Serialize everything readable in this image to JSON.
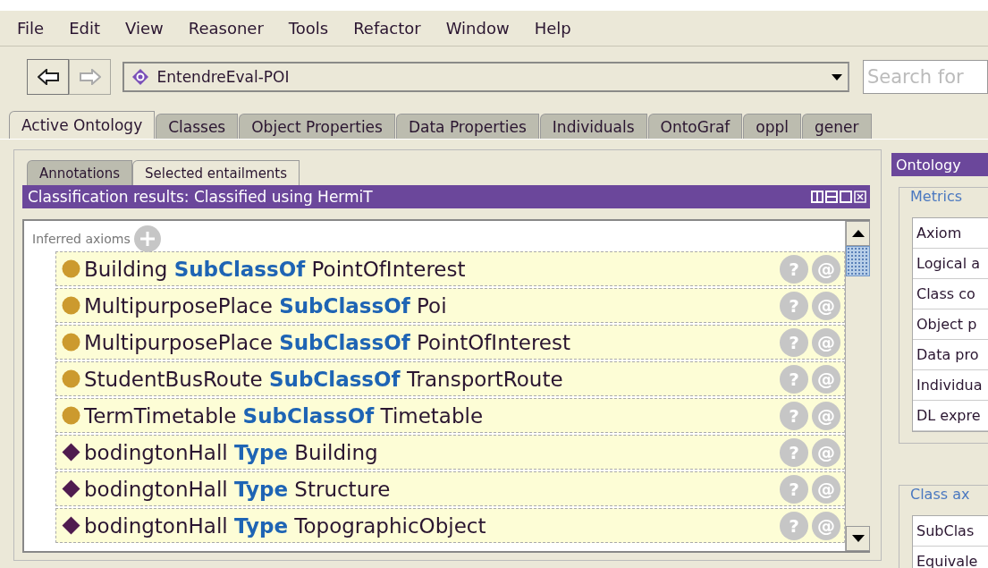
{
  "menu": [
    "File",
    "Edit",
    "View",
    "Reasoner",
    "Tools",
    "Refactor",
    "Window",
    "Help"
  ],
  "toolbar": {
    "ontology": "EntendreEval-POI",
    "search": {
      "placeholder": "Search for"
    }
  },
  "tabs": [
    {
      "label": "Active Ontology",
      "selected": true
    },
    {
      "label": "Classes",
      "selected": false
    },
    {
      "label": "Object Properties",
      "selected": false
    },
    {
      "label": "Data Properties",
      "selected": false
    },
    {
      "label": "Individuals",
      "selected": false
    },
    {
      "label": "OntoGraf",
      "selected": false
    },
    {
      "label": "oppl",
      "selected": false
    },
    {
      "label": "gener",
      "selected": false
    }
  ],
  "left_panel": {
    "tabs": [
      {
        "label": "Annotations",
        "selected": false
      },
      {
        "label": "Selected entailments",
        "selected": true
      }
    ],
    "title": "Classification results: Classified using HermiT",
    "section": "Inferred axioms",
    "axioms": [
      {
        "kind": "class",
        "text": "Building **SubClassOf** PointOfInterest",
        "actions": [
          "?",
          "@"
        ]
      },
      {
        "kind": "class",
        "text": "MultipurposePlace **SubClassOf** Poi",
        "actions": [
          "?",
          "@"
        ]
      },
      {
        "kind": "class",
        "text": "MultipurposePlace **SubClassOf** PointOfInterest",
        "actions": [
          "?",
          "@"
        ]
      },
      {
        "kind": "class",
        "text": "StudentBusRoute **SubClassOf** TransportRoute",
        "actions": [
          "?",
          "@"
        ]
      },
      {
        "kind": "class",
        "text": "TermTimetable **SubClassOf** Timetable",
        "actions": [
          "?",
          "@"
        ]
      },
      {
        "kind": "individual",
        "text": "bodingtonHall **Type** Building",
        "actions": [
          "?",
          "@"
        ]
      },
      {
        "kind": "individual",
        "text": "bodingtonHall **Type** Structure",
        "actions": [
          "?",
          "@"
        ]
      },
      {
        "kind": "individual",
        "text": "bodingtonHall **Type** TopographicObject",
        "actions": [
          "?",
          "@"
        ]
      }
    ]
  },
  "right_panel": {
    "title": "Ontology",
    "metrics": {
      "legend": "Metrics",
      "rows": [
        "Axiom",
        "Logical a",
        "Class co",
        "Object p",
        "Data pro",
        "Individua",
        "DL expre"
      ]
    },
    "class_axioms": {
      "legend": "Class ax",
      "rows": [
        "SubClas",
        "Equivale"
      ]
    }
  }
}
